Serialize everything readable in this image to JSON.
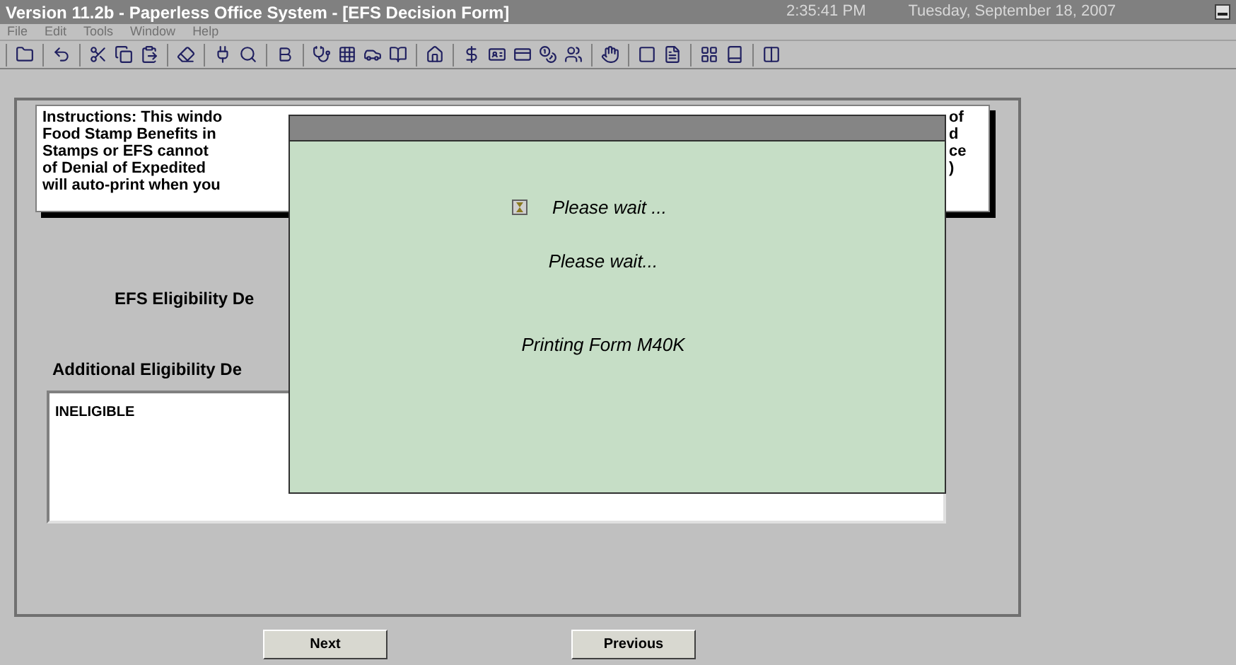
{
  "window": {
    "title": "Version 11.2b - Paperless Office System - [EFS Decision Form]",
    "time": "2:35:41 PM",
    "date": "Tuesday, September 18, 2007"
  },
  "menu": [
    "File",
    "Edit",
    "Tools",
    "Window",
    "Help"
  ],
  "form": {
    "instructions_left": [
      "Instructions: This windo",
      "Food Stamp Benefits in",
      "Stamps or EFS cannot ",
      "of Denial of Expedited ",
      "will auto-print when you"
    ],
    "instructions_right": [
      "of",
      "d",
      "ce",
      ")"
    ],
    "eligibility_label": "EFS Eligibility De",
    "additional_label": "Additional Eligibility De",
    "additional_value": "INELIGIBLE"
  },
  "dialog": {
    "lines": [
      "Please wait ...",
      "Please wait...",
      "Printing Form M40K"
    ]
  },
  "buttons": [
    "Next",
    "Previous"
  ]
}
